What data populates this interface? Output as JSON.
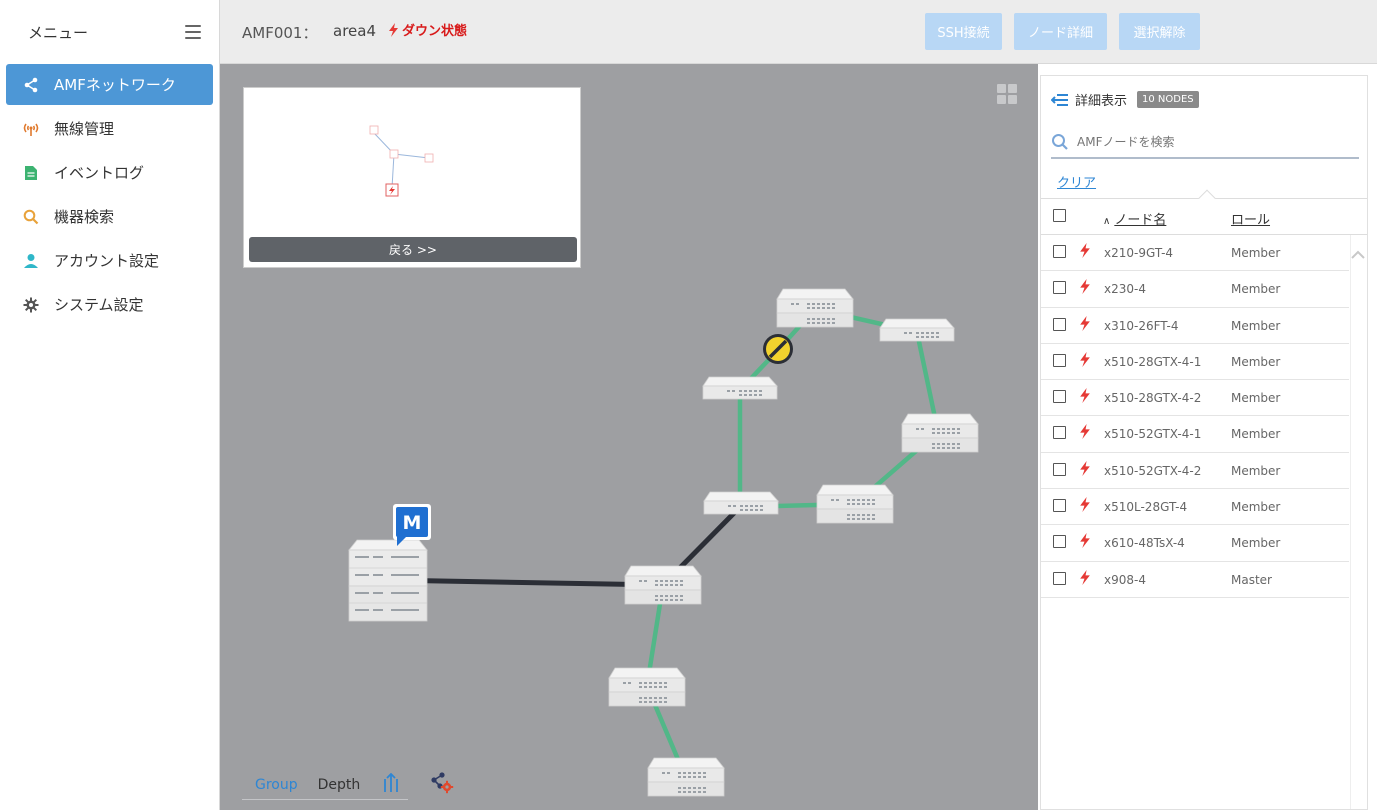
{
  "sidebar": {
    "title": "メニュー",
    "items": [
      {
        "label": "AMFネットワーク",
        "icon": "share-network-icon",
        "active": true
      },
      {
        "label": "無線管理",
        "icon": "wireless-icon",
        "active": false
      },
      {
        "label": "イベントログ",
        "icon": "document-icon",
        "active": false
      },
      {
        "label": "機器検索",
        "icon": "search-icon",
        "active": false
      },
      {
        "label": "アカウント設定",
        "icon": "user-icon",
        "active": false
      },
      {
        "label": "システム設定",
        "icon": "gear-icon",
        "active": false
      }
    ]
  },
  "header": {
    "title": "AMF001：",
    "area": "area4",
    "status": "ダウン状態",
    "buttons": {
      "ssh": "SSH接続",
      "node_detail": "ノード詳細",
      "deselect": "選択解除"
    }
  },
  "minimap": {
    "back_label": "戻る >>"
  },
  "canvas": {
    "master_badge": "M",
    "tabs": {
      "group": "Group",
      "depth": "Depth"
    }
  },
  "panel": {
    "title": "詳細表示",
    "badge": "10 NODES",
    "search_placeholder": "AMFノードを検索",
    "clear_label": "クリア",
    "columns": {
      "name": "ノード名",
      "role": "ロール"
    },
    "rows": [
      {
        "name": "x210-9GT-4",
        "role": "Member"
      },
      {
        "name": "x230-4",
        "role": "Member"
      },
      {
        "name": "x310-26FT-4",
        "role": "Member"
      },
      {
        "name": "x510-28GTX-4-1",
        "role": "Member"
      },
      {
        "name": "x510-28GTX-4-2",
        "role": "Member"
      },
      {
        "name": "x510-52GTX-4-1",
        "role": "Member"
      },
      {
        "name": "x510-52GTX-4-2",
        "role": "Member"
      },
      {
        "name": "x510L-28GT-4",
        "role": "Member"
      },
      {
        "name": "x610-48TsX-4",
        "role": "Member"
      },
      {
        "name": "x908-4",
        "role": "Master"
      }
    ]
  },
  "colors": {
    "accent": "#4d97d6",
    "down_red": "#d81b1b",
    "link_green": "#52b788",
    "link_dark": "#2b2e36",
    "canvas_bg": "#9e9fa2"
  }
}
